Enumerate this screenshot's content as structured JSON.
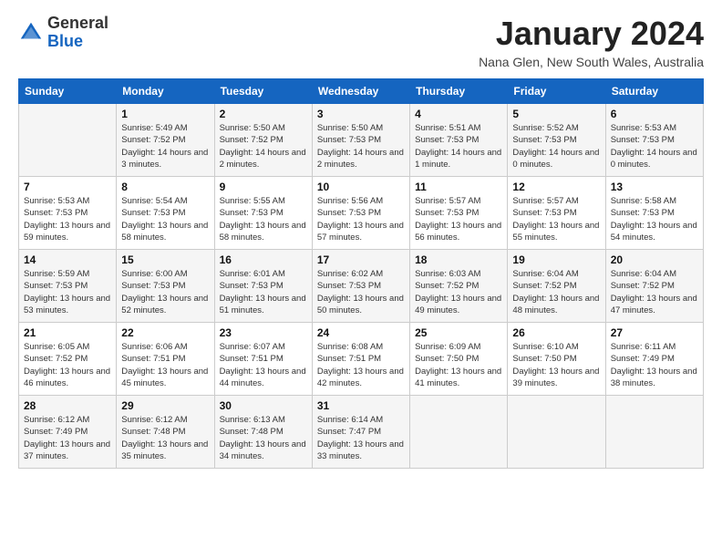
{
  "header": {
    "logo_line1": "General",
    "logo_line2": "Blue",
    "month": "January 2024",
    "location": "Nana Glen, New South Wales, Australia"
  },
  "days_of_week": [
    "Sunday",
    "Monday",
    "Tuesday",
    "Wednesday",
    "Thursday",
    "Friday",
    "Saturday"
  ],
  "weeks": [
    [
      {
        "day": "",
        "sunrise": "",
        "sunset": "",
        "daylight": ""
      },
      {
        "day": "1",
        "sunrise": "5:49 AM",
        "sunset": "7:52 PM",
        "daylight": "14 hours and 3 minutes."
      },
      {
        "day": "2",
        "sunrise": "5:50 AM",
        "sunset": "7:52 PM",
        "daylight": "14 hours and 2 minutes."
      },
      {
        "day": "3",
        "sunrise": "5:50 AM",
        "sunset": "7:53 PM",
        "daylight": "14 hours and 2 minutes."
      },
      {
        "day": "4",
        "sunrise": "5:51 AM",
        "sunset": "7:53 PM",
        "daylight": "14 hours and 1 minute."
      },
      {
        "day": "5",
        "sunrise": "5:52 AM",
        "sunset": "7:53 PM",
        "daylight": "14 hours and 0 minutes."
      },
      {
        "day": "6",
        "sunrise": "5:53 AM",
        "sunset": "7:53 PM",
        "daylight": "14 hours and 0 minutes."
      }
    ],
    [
      {
        "day": "7",
        "sunrise": "5:53 AM",
        "sunset": "7:53 PM",
        "daylight": "13 hours and 59 minutes."
      },
      {
        "day": "8",
        "sunrise": "5:54 AM",
        "sunset": "7:53 PM",
        "daylight": "13 hours and 58 minutes."
      },
      {
        "day": "9",
        "sunrise": "5:55 AM",
        "sunset": "7:53 PM",
        "daylight": "13 hours and 58 minutes."
      },
      {
        "day": "10",
        "sunrise": "5:56 AM",
        "sunset": "7:53 PM",
        "daylight": "13 hours and 57 minutes."
      },
      {
        "day": "11",
        "sunrise": "5:57 AM",
        "sunset": "7:53 PM",
        "daylight": "13 hours and 56 minutes."
      },
      {
        "day": "12",
        "sunrise": "5:57 AM",
        "sunset": "7:53 PM",
        "daylight": "13 hours and 55 minutes."
      },
      {
        "day": "13",
        "sunrise": "5:58 AM",
        "sunset": "7:53 PM",
        "daylight": "13 hours and 54 minutes."
      }
    ],
    [
      {
        "day": "14",
        "sunrise": "5:59 AM",
        "sunset": "7:53 PM",
        "daylight": "13 hours and 53 minutes."
      },
      {
        "day": "15",
        "sunrise": "6:00 AM",
        "sunset": "7:53 PM",
        "daylight": "13 hours and 52 minutes."
      },
      {
        "day": "16",
        "sunrise": "6:01 AM",
        "sunset": "7:53 PM",
        "daylight": "13 hours and 51 minutes."
      },
      {
        "day": "17",
        "sunrise": "6:02 AM",
        "sunset": "7:53 PM",
        "daylight": "13 hours and 50 minutes."
      },
      {
        "day": "18",
        "sunrise": "6:03 AM",
        "sunset": "7:52 PM",
        "daylight": "13 hours and 49 minutes."
      },
      {
        "day": "19",
        "sunrise": "6:04 AM",
        "sunset": "7:52 PM",
        "daylight": "13 hours and 48 minutes."
      },
      {
        "day": "20",
        "sunrise": "6:04 AM",
        "sunset": "7:52 PM",
        "daylight": "13 hours and 47 minutes."
      }
    ],
    [
      {
        "day": "21",
        "sunrise": "6:05 AM",
        "sunset": "7:52 PM",
        "daylight": "13 hours and 46 minutes."
      },
      {
        "day": "22",
        "sunrise": "6:06 AM",
        "sunset": "7:51 PM",
        "daylight": "13 hours and 45 minutes."
      },
      {
        "day": "23",
        "sunrise": "6:07 AM",
        "sunset": "7:51 PM",
        "daylight": "13 hours and 44 minutes."
      },
      {
        "day": "24",
        "sunrise": "6:08 AM",
        "sunset": "7:51 PM",
        "daylight": "13 hours and 42 minutes."
      },
      {
        "day": "25",
        "sunrise": "6:09 AM",
        "sunset": "7:50 PM",
        "daylight": "13 hours and 41 minutes."
      },
      {
        "day": "26",
        "sunrise": "6:10 AM",
        "sunset": "7:50 PM",
        "daylight": "13 hours and 39 minutes."
      },
      {
        "day": "27",
        "sunrise": "6:11 AM",
        "sunset": "7:49 PM",
        "daylight": "13 hours and 38 minutes."
      }
    ],
    [
      {
        "day": "28",
        "sunrise": "6:12 AM",
        "sunset": "7:49 PM",
        "daylight": "13 hours and 37 minutes."
      },
      {
        "day": "29",
        "sunrise": "6:12 AM",
        "sunset": "7:48 PM",
        "daylight": "13 hours and 35 minutes."
      },
      {
        "day": "30",
        "sunrise": "6:13 AM",
        "sunset": "7:48 PM",
        "daylight": "13 hours and 34 minutes."
      },
      {
        "day": "31",
        "sunrise": "6:14 AM",
        "sunset": "7:47 PM",
        "daylight": "13 hours and 33 minutes."
      },
      {
        "day": "",
        "sunrise": "",
        "sunset": "",
        "daylight": ""
      },
      {
        "day": "",
        "sunrise": "",
        "sunset": "",
        "daylight": ""
      },
      {
        "day": "",
        "sunrise": "",
        "sunset": "",
        "daylight": ""
      }
    ]
  ],
  "labels": {
    "sunrise_prefix": "Sunrise: ",
    "sunset_prefix": "Sunset: ",
    "daylight_prefix": "Daylight: "
  }
}
